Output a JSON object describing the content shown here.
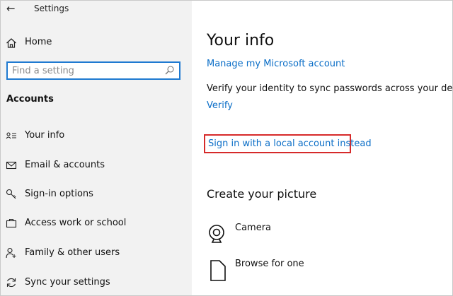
{
  "window": {
    "title": "Settings"
  },
  "sidebar": {
    "home_label": "Home",
    "search_placeholder": "Find a setting",
    "section_title": "Accounts",
    "items": [
      {
        "label": "Your info",
        "icon": "contact-card-icon"
      },
      {
        "label": "Email & accounts",
        "icon": "email-icon"
      },
      {
        "label": "Sign-in options",
        "icon": "key-icon"
      },
      {
        "label": "Access work or school",
        "icon": "briefcase-icon"
      },
      {
        "label": "Family & other users",
        "icon": "person-add-icon"
      },
      {
        "label": "Sync your settings",
        "icon": "sync-icon"
      }
    ]
  },
  "main": {
    "title": "Your info",
    "manage_link": "Manage my Microsoft account",
    "verify_text": "Verify your identity to sync passwords across your devices.",
    "verify_link": "Verify",
    "signin_link": "Sign in with a local account instead",
    "picture_section": {
      "title": "Create your picture",
      "options": [
        {
          "label": "Camera",
          "icon": "camera-icon"
        },
        {
          "label": "Browse for one",
          "icon": "browse-file-icon"
        }
      ]
    }
  },
  "colors": {
    "accent": "#0b6ec7",
    "search_border": "#1f7ad1",
    "highlight": "#d62a2a",
    "sidebar_bg": "#f2f2f2"
  }
}
